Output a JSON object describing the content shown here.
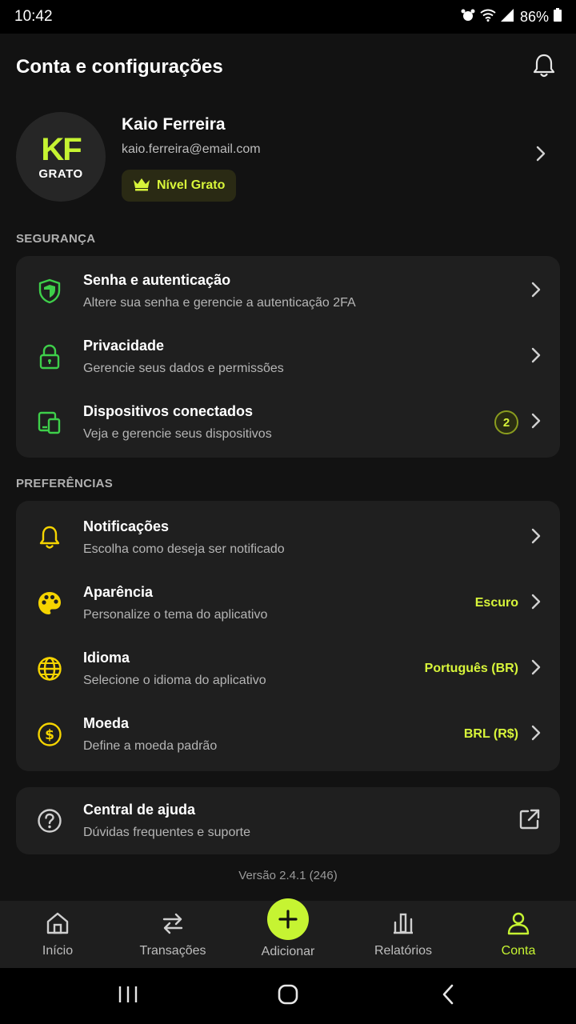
{
  "status": {
    "time": "10:42",
    "battery": "86%"
  },
  "header": {
    "title": "Conta e configurações"
  },
  "profile": {
    "initials": "KF",
    "tier": "GRATO",
    "name": "Kaio Ferreira",
    "email": "kaio.ferreira@email.com",
    "level": "Nível Grato"
  },
  "security": {
    "label": "SEGURANÇA",
    "items": [
      {
        "title": "Senha e autenticação",
        "subtitle": "Altere sua senha e gerencie a autenticação 2FA",
        "icon": "shield-icon"
      },
      {
        "title": "Privacidade",
        "subtitle": "Gerencie seus dados e permissões",
        "icon": "lock-icon"
      },
      {
        "title": "Dispositivos conectados",
        "subtitle": "Veja e gerencie seus dispositivos",
        "icon": "devices-icon",
        "badge": "2"
      }
    ]
  },
  "preferences": {
    "label": "PREFERÊNCIAS",
    "items": [
      {
        "title": "Notificações",
        "subtitle": "Escolha como deseja ser notificado",
        "icon": "bell-icon"
      },
      {
        "title": "Aparência",
        "subtitle": "Personalize o tema do aplicativo",
        "icon": "palette-icon",
        "value": "Escuro"
      },
      {
        "title": "Idioma",
        "subtitle": "Selecione o idioma do aplicativo",
        "icon": "globe-icon",
        "value": "Português (BR)"
      },
      {
        "title": "Moeda",
        "subtitle": "Define a moeda padrão",
        "icon": "dollar-icon",
        "value": "BRL (R$)"
      }
    ]
  },
  "help": {
    "title": "Central de ajuda",
    "subtitle": "Dúvidas frequentes e suporte",
    "icon": "help-icon"
  },
  "version": "Versão 2.4.1 (246)",
  "nav": {
    "items": [
      {
        "label": "Início",
        "icon": "home-icon"
      },
      {
        "label": "Transações",
        "icon": "transfer-icon"
      },
      {
        "label": "Adicionar",
        "icon": "plus-icon"
      },
      {
        "label": "Relatórios",
        "icon": "chart-icon"
      },
      {
        "label": "Conta",
        "icon": "user-icon",
        "active": true
      }
    ]
  },
  "colors": {
    "accent": "#c6f432",
    "yellow": "#f5d400",
    "green": "#3ecf4a",
    "background": "#121212",
    "card": "#1f1f1f"
  }
}
